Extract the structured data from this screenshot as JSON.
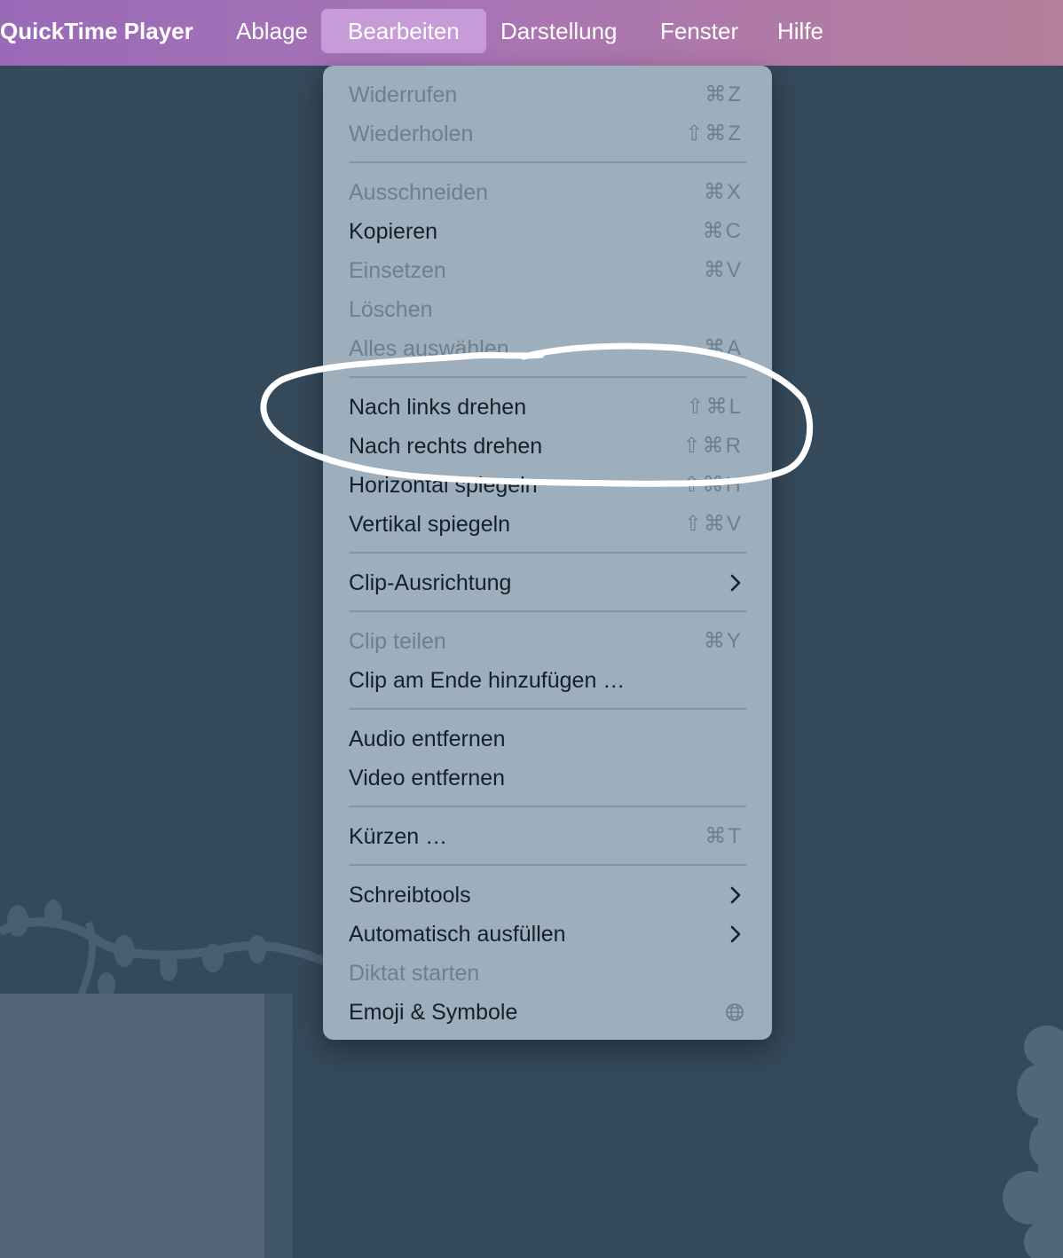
{
  "menubar": {
    "app": "QuickTime Player",
    "items": [
      "Ablage",
      "Bearbeiten",
      "Darstellung",
      "Fenster",
      "Hilfe"
    ]
  },
  "menu": {
    "items": [
      {
        "label": "Widerrufen",
        "shortcut": "⌘Z",
        "enabled": false
      },
      {
        "label": "Wiederholen",
        "shortcut": "⇧⌘Z",
        "enabled": false
      },
      {
        "label": "Ausschneiden",
        "shortcut": "⌘X",
        "enabled": false
      },
      {
        "label": "Kopieren",
        "shortcut": "⌘C",
        "enabled": true
      },
      {
        "label": "Einsetzen",
        "shortcut": "⌘V",
        "enabled": false
      },
      {
        "label": "Löschen",
        "shortcut": "",
        "enabled": false
      },
      {
        "label": "Alles auswählen",
        "shortcut": "⌘A",
        "enabled": false
      },
      {
        "label": "Nach links drehen",
        "shortcut": "⇧⌘L",
        "enabled": true
      },
      {
        "label": "Nach rechts drehen",
        "shortcut": "⇧⌘R",
        "enabled": true
      },
      {
        "label": "Horizontal spiegeln",
        "shortcut": "⇧⌘H",
        "enabled": true
      },
      {
        "label": "Vertikal spiegeln",
        "shortcut": "⇧⌘V",
        "enabled": true
      },
      {
        "label": "Clip-Ausrichtung",
        "submenu": true,
        "enabled": true
      },
      {
        "label": "Clip teilen",
        "shortcut": "⌘Y",
        "enabled": false
      },
      {
        "label": "Clip am Ende hinzufügen …",
        "shortcut": "",
        "enabled": true
      },
      {
        "label": "Audio entfernen",
        "shortcut": "",
        "enabled": true
      },
      {
        "label": "Video entfernen",
        "shortcut": "",
        "enabled": true
      },
      {
        "label": "Kürzen …",
        "shortcut": "⌘T",
        "enabled": true
      },
      {
        "label": "Schreibtools",
        "submenu": true,
        "enabled": true
      },
      {
        "label": "Automatisch ausfüllen",
        "submenu": true,
        "enabled": true
      },
      {
        "label": "Diktat starten",
        "shortcut": "",
        "enabled": false
      },
      {
        "label": "Emoji & Symbole",
        "icon": "globe-icon",
        "enabled": true
      }
    ]
  },
  "annotation": {
    "icon": "hand-drawn-circle",
    "color": "#ffffff"
  },
  "colors": {
    "menubar_start": "#9a6ab8",
    "menubar_end": "#b47f9a",
    "menu_bg": "#9daebd",
    "desktop": "#33495a"
  }
}
